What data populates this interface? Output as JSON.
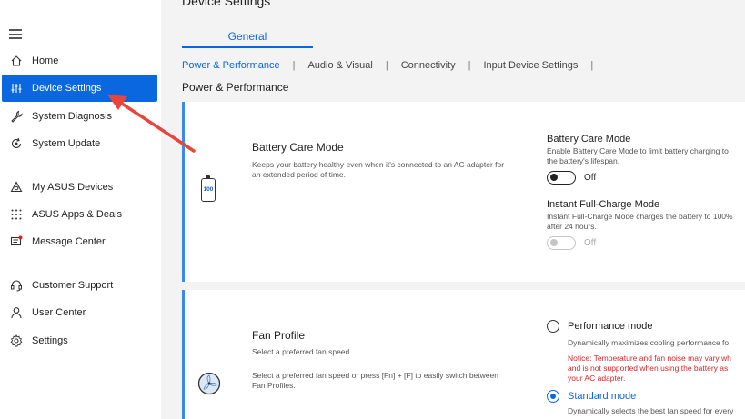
{
  "sidebar": {
    "items": [
      {
        "label": "Home",
        "icon": "home-icon"
      },
      {
        "label": "Device Settings",
        "icon": "sliders-icon"
      },
      {
        "label": "System Diagnosis",
        "icon": "wrench-icon"
      },
      {
        "label": "System Update",
        "icon": "update-icon"
      },
      {
        "label": "My ASUS Devices",
        "icon": "devices-icon"
      },
      {
        "label": "ASUS Apps & Deals",
        "icon": "apps-grid-icon"
      },
      {
        "label": "Message Center",
        "icon": "message-icon"
      },
      {
        "label": "Customer Support",
        "icon": "headset-icon"
      },
      {
        "label": "User Center",
        "icon": "user-icon"
      },
      {
        "label": "Settings",
        "icon": "gear-icon"
      }
    ],
    "active_index": 1,
    "accent_color": "#0a67e0"
  },
  "main": {
    "page_title": "Device Settings",
    "tab": "General",
    "subtabs": [
      "Power & Performance",
      "Audio & Visual",
      "Connectivity",
      "Input Device Settings"
    ],
    "section_heading": "Power & Performance",
    "battery_card": {
      "title": "Battery Care Mode",
      "desc_line1": "Keeps your battery healthy even when it's connected to an AC adapter for",
      "desc_line2": "an extended period of time.",
      "icon_text": "100",
      "option1": {
        "title": "Battery Care Mode",
        "desc_line1": "Enable Battery Care Mode to limit battery charging to",
        "desc_line2": "the battery's lifespan.",
        "toggle_label": "Off"
      },
      "option2": {
        "title": "Instant Full-Charge Mode",
        "desc_line1": "Instant Full-Charge Mode charges the battery to 100%",
        "desc_line2": "after 24 hours.",
        "toggle_label": "Off"
      }
    },
    "fan_card": {
      "title": "Fan Profile",
      "subtitle": "Select a preferred fan speed.",
      "desc_line1": "Select a preferred fan speed or press [Fn] + [F] to easily switch between",
      "desc_line2": "Fan Profiles.",
      "performance": {
        "label": "Performance mode",
        "desc": "Dynamically maximizes cooling performance fo",
        "notice_line1": "Notice: Temperature and fan noise may vary wh",
        "notice_line2": "and is not supported when using the battery as",
        "notice_line3": "your AC adapter."
      },
      "standard": {
        "label": "Standard mode",
        "desc": "Dynamically selects the best fan speed for every"
      }
    }
  },
  "annotation_color": "#e8453c"
}
